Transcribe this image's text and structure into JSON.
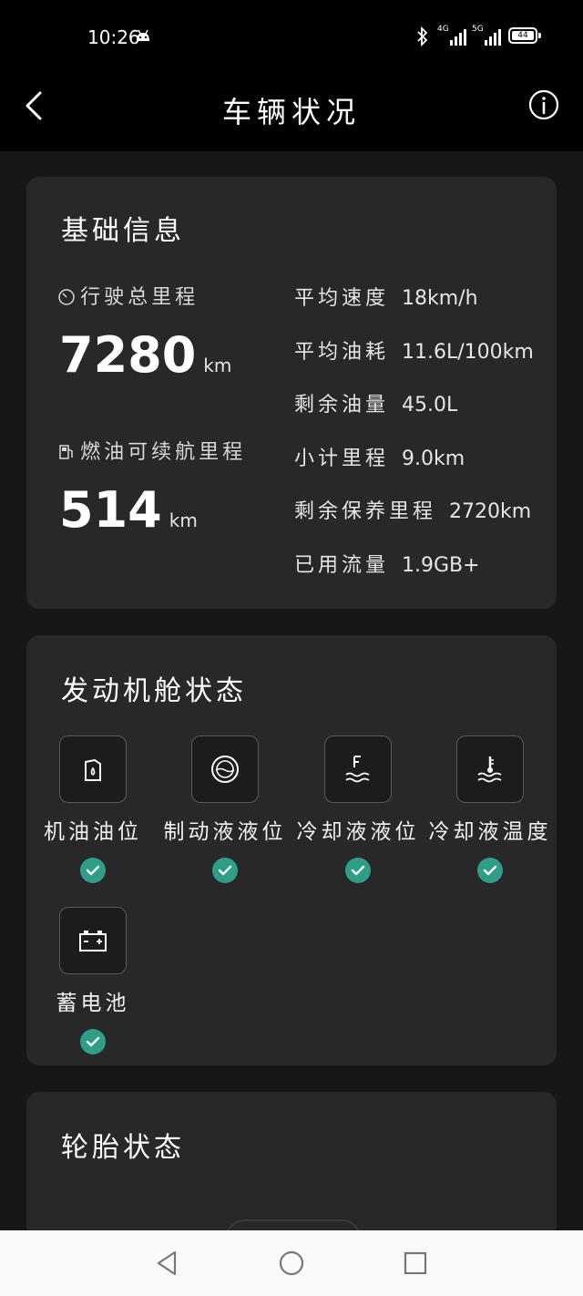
{
  "status_bar": {
    "time": "10:26",
    "network_1": "4G",
    "network_2": "5G",
    "battery": "44"
  },
  "header": {
    "title": "车辆状况"
  },
  "basic_info": {
    "title": "基础信息",
    "total_mileage_label": "行驶总里程",
    "total_mileage_value": "7280",
    "total_mileage_unit": "km",
    "range_label": "燃油可续航里程",
    "range_value": "514",
    "range_unit": "km",
    "stats": [
      {
        "label": "平均速度",
        "value": "18km/h"
      },
      {
        "label": "平均油耗",
        "value": "11.6L/100km"
      },
      {
        "label": "剩余油量",
        "value": "45.0L"
      },
      {
        "label": "小计里程",
        "value": "9.0km"
      },
      {
        "label": "剩余保养里程",
        "value": "2720km"
      },
      {
        "label": "已用流量",
        "value": "1.9GB+"
      }
    ]
  },
  "engine": {
    "title": "发动机舱状态",
    "items": [
      {
        "label": "机油油位",
        "icon": "oil-can-icon",
        "status": "ok"
      },
      {
        "label": "制动液液位",
        "icon": "brake-fluid-icon",
        "status": "ok"
      },
      {
        "label": "冷却液液位",
        "icon": "coolant-level-icon",
        "status": "ok"
      },
      {
        "label": "冷却液温度",
        "icon": "coolant-temp-icon",
        "status": "ok"
      },
      {
        "label": "蓄电池",
        "icon": "battery-icon",
        "status": "ok"
      }
    ]
  },
  "tire": {
    "title": "轮胎状态"
  },
  "colors": {
    "background": "#171717",
    "card": "#282828",
    "check": "#2e9e86"
  }
}
